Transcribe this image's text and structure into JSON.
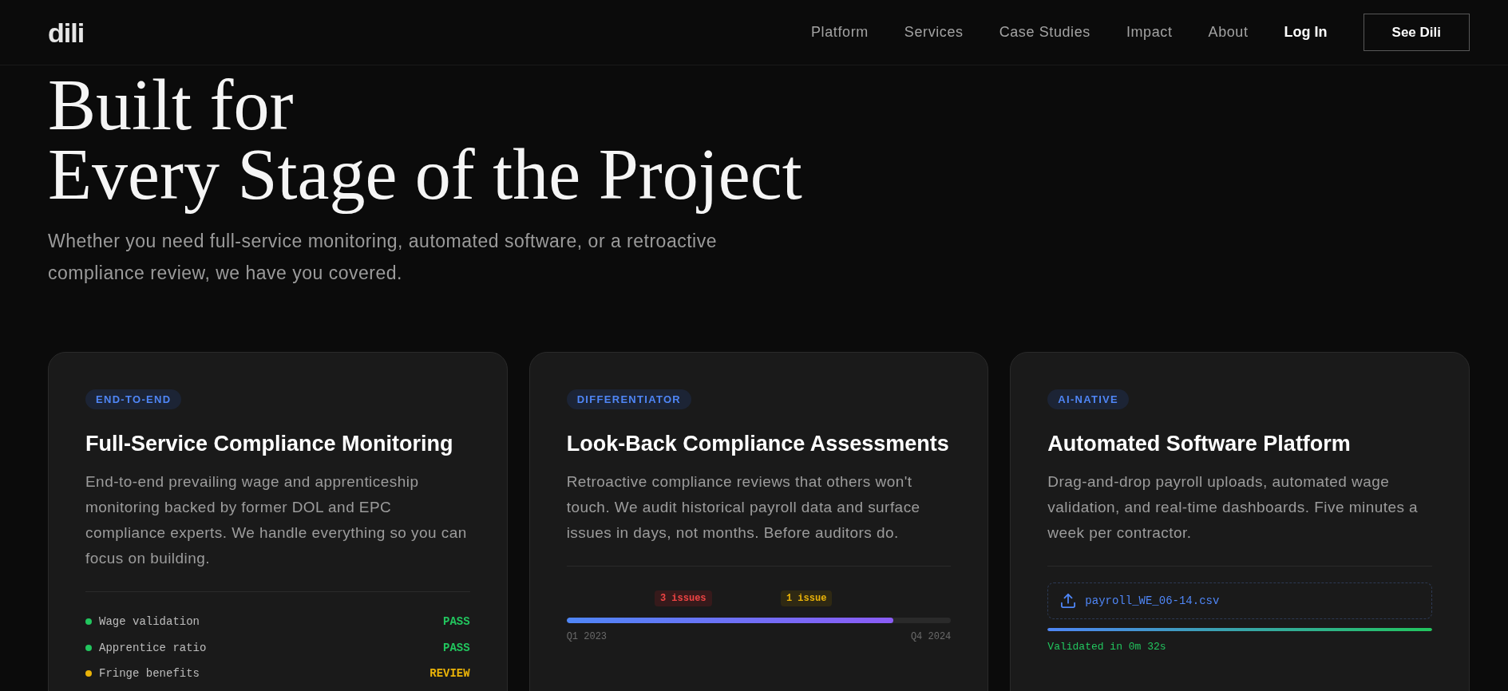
{
  "nav": {
    "logo": "dili",
    "links": [
      "Platform",
      "Services",
      "Case Studies",
      "Impact",
      "About"
    ],
    "login": "Log In",
    "cta": "See Dili"
  },
  "hero": {
    "title": "Built for\nEvery Stage of the Project",
    "subtitle": "Whether you need full-service monitoring, automated software, or a retroactive compliance review, we have you covered."
  },
  "cards": [
    {
      "kind": "checklist",
      "badge": "END-TO-END",
      "title": "Full-Service Compliance Monitoring",
      "description": "End-to-end prevailing wage and apprenticeship monitoring backed by former DOL and EPC compliance experts. We handle everything so you can focus on building.",
      "checks": [
        {
          "label": "Wage validation",
          "status": "PASS",
          "color": "#22c55e"
        },
        {
          "label": "Apprentice ratio",
          "status": "PASS",
          "color": "#22c55e"
        },
        {
          "label": "Fringe benefits",
          "status": "REVIEW",
          "color": "#eab308"
        }
      ]
    },
    {
      "kind": "timeline",
      "badge": "DIFFERENTIATOR",
      "title": "Look-Back Compliance Assessments",
      "description": "Retroactive compliance reviews that others won't touch. We audit historical payroll data and surface issues in days, not months. Before auditors do.",
      "timeline": {
        "markers": [
          {
            "label": "3 issues",
            "kind": "error"
          },
          {
            "label": "1 issue",
            "kind": "warning"
          }
        ],
        "level": 0.85,
        "start": "Q1 2023",
        "end": "Q4 2024"
      }
    },
    {
      "kind": "upload",
      "badge": "AI-NATIVE",
      "title": "Automated Software Platform",
      "description": "Drag-and-drop payroll uploads, automated wage validation, and real-time dashboards. Five minutes a week per contractor.",
      "upload": {
        "file": "payroll_WE_06-14.csv",
        "level": 1,
        "status": "Validated in 0m 32s"
      }
    }
  ]
}
